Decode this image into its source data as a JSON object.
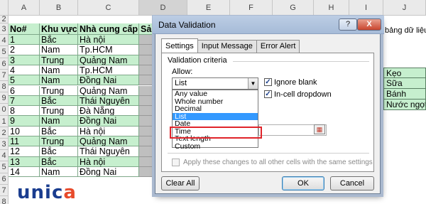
{
  "sheet": {
    "columns": [
      "A",
      "B",
      "C",
      "D",
      "E",
      "F",
      "G",
      "H",
      "I",
      "J"
    ],
    "rows": [
      "2",
      "3",
      "4",
      "5",
      "6",
      "7",
      "8",
      "9",
      "0",
      "1",
      "2",
      "3",
      "4",
      "5",
      "6",
      "7",
      "8"
    ],
    "headers": {
      "no": "No#",
      "region": "Khu vực",
      "supplier": "Nhà cung cấp",
      "product": "Sản"
    },
    "data": [
      [
        "1",
        "Bắc",
        "Hà nội"
      ],
      [
        "2",
        "Nam",
        "Tp.HCM"
      ],
      [
        "3",
        "Trung",
        "Quảng Nam"
      ],
      [
        "4",
        "Nam",
        "Tp.HCM"
      ],
      [
        "5",
        "Nam",
        "Đồng Nai"
      ],
      [
        "6",
        "Trung",
        "Quảng Nam"
      ],
      [
        "7",
        "Bắc",
        "Thái Nguyên"
      ],
      [
        "8",
        "Trung",
        "Đà Nẵng"
      ],
      [
        "9",
        "Nam",
        "Đồng Nai"
      ],
      [
        "10",
        "Bắc",
        "Hà nội"
      ],
      [
        "11",
        "Trung",
        "Quảng Nam"
      ],
      [
        "12",
        "Bắc",
        "Thái Nguyên"
      ],
      [
        "13",
        "Bắc",
        "Hà nội"
      ],
      [
        "14",
        "Nam",
        "Đồng Nai"
      ]
    ],
    "behind_dialog_text": "bảng dữ liệu",
    "j_list": [
      "Kẹo",
      "Sữa",
      "Bánh",
      "Nước ngọt"
    ]
  },
  "logo": {
    "text": "unica"
  },
  "dialog": {
    "title": "Data Validation",
    "help_label": "?",
    "close_label": "X",
    "tabs": [
      "Settings",
      "Input Message",
      "Error Alert"
    ],
    "validation_criteria_label": "Validation criteria",
    "allow_label": "Allow:",
    "allow_value": "List",
    "allow_options": [
      "Any value",
      "Whole number",
      "Decimal",
      "List",
      "Date",
      "Time",
      "Text length",
      "Custom"
    ],
    "selected_option": "List",
    "ignore_blank_label": "Ignore blank",
    "ignore_blank_checked": true,
    "in_cell_dropdown_label": "In-cell dropdown",
    "in_cell_dropdown_checked": true,
    "apply_label": "Apply these changes to all other cells with the same settings",
    "clear_all_label": "Clear All",
    "ok_label": "OK",
    "cancel_label": "Cancel"
  },
  "colors": {
    "cell_green": "#c6efce",
    "highlight_red": "#e0242a",
    "selection_blue": "#3399ff"
  }
}
